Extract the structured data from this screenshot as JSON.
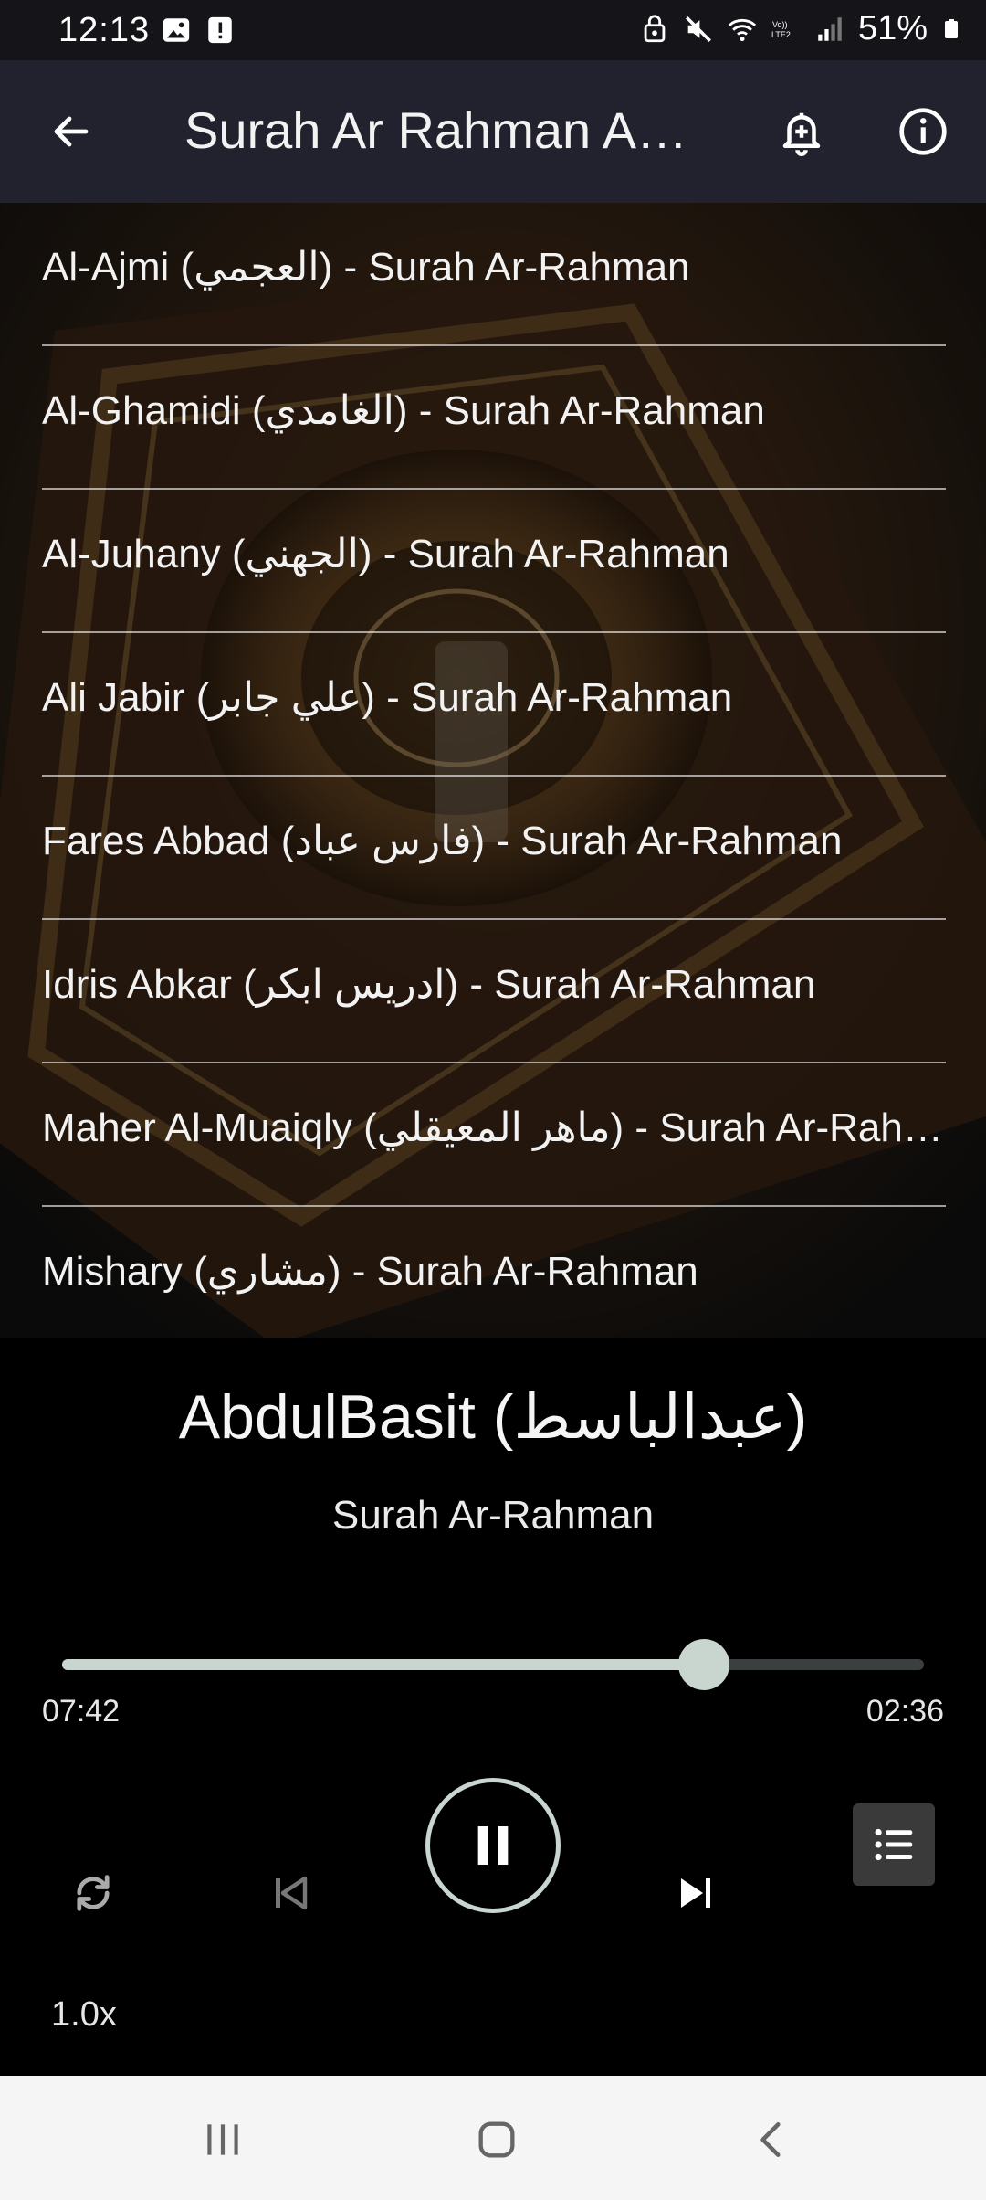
{
  "status_bar": {
    "time": "12:13",
    "battery": "51%",
    "icons": [
      "image-icon",
      "alert-icon",
      "vpn-icon",
      "mute-icon",
      "wifi-icon",
      "volte-icon",
      "signal-icon",
      "battery-icon"
    ]
  },
  "app_bar": {
    "title": "Surah Ar Rahman Au...",
    "back_icon": "arrow-left-icon",
    "actions": [
      "bell-plus-icon",
      "info-icon"
    ]
  },
  "reciters": [
    "Al-Ajmi (العجمي) - Surah Ar-Rahman",
    "Al-Ghamidi (الغامدي) - Surah Ar-Rahman",
    "Al-Juhany (الجهني) - Surah Ar-Rahman",
    "Ali Jabir (علي جابر) - Surah Ar-Rahman",
    "Fares Abbad (فارس عباد) - Surah Ar-Rahman",
    "Idris Abkar (ادريس ابكر) - Surah Ar-Rahman",
    "Maher Al-Muaiqly (ماهر المعيقلي) - Surah Ar-Rahm...",
    "Mishary (مشاري) - Surah Ar-Rahman"
  ],
  "now_playing": {
    "reciter": "AbdulBasit (عبدالباسط)",
    "surah": "Surah Ar-Rahman",
    "elapsed": "07:42",
    "remaining": "02:36",
    "progress": 0.745,
    "speed": "1.0x",
    "state": "playing"
  },
  "controls": [
    "repeat-icon",
    "skip-previous-icon",
    "pause-icon",
    "skip-next-icon",
    "playlist-icon"
  ],
  "colors": {
    "accent": "#c9d6d0",
    "app_bar": "#22222e",
    "status_bar": "#141419"
  }
}
